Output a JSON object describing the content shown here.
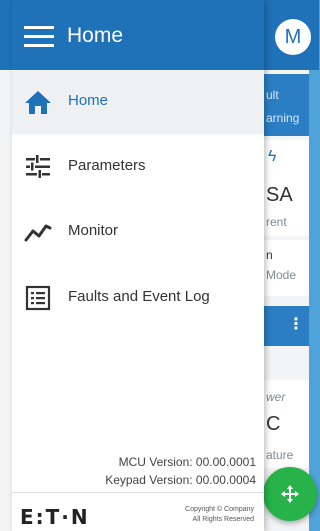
{
  "app": {
    "avatar_letter": "M",
    "background_fragments": {
      "card1_line1": "ult",
      "card1_line2": "arning",
      "card2_big": "SA",
      "card2_sub": "rent",
      "card3_line1": "n",
      "card3_line2": "Mode",
      "card5_line1": "wer",
      "card5_big": "C",
      "card5_line2": "ature"
    }
  },
  "drawer": {
    "title": "Home",
    "items": [
      {
        "label": "Home",
        "icon": "home-icon",
        "active": true
      },
      {
        "label": "Parameters",
        "icon": "sliders-icon",
        "active": false
      },
      {
        "label": "Monitor",
        "icon": "trend-line-icon",
        "active": false
      },
      {
        "label": "Faults and Event Log",
        "icon": "event-log-icon",
        "active": false
      }
    ],
    "mcu_version": "MCU Version: 00.00.0001",
    "keypad_version": "Keypad Version: 00.00.0004",
    "logo_text": "E:T·N",
    "copyright_line1": "Copyright © Company",
    "copyright_line2": "All Rights Reserved"
  },
  "colors": {
    "primary": "#1f71b8",
    "fab": "#27b34a",
    "active_item_bg": "#eef0f2"
  }
}
